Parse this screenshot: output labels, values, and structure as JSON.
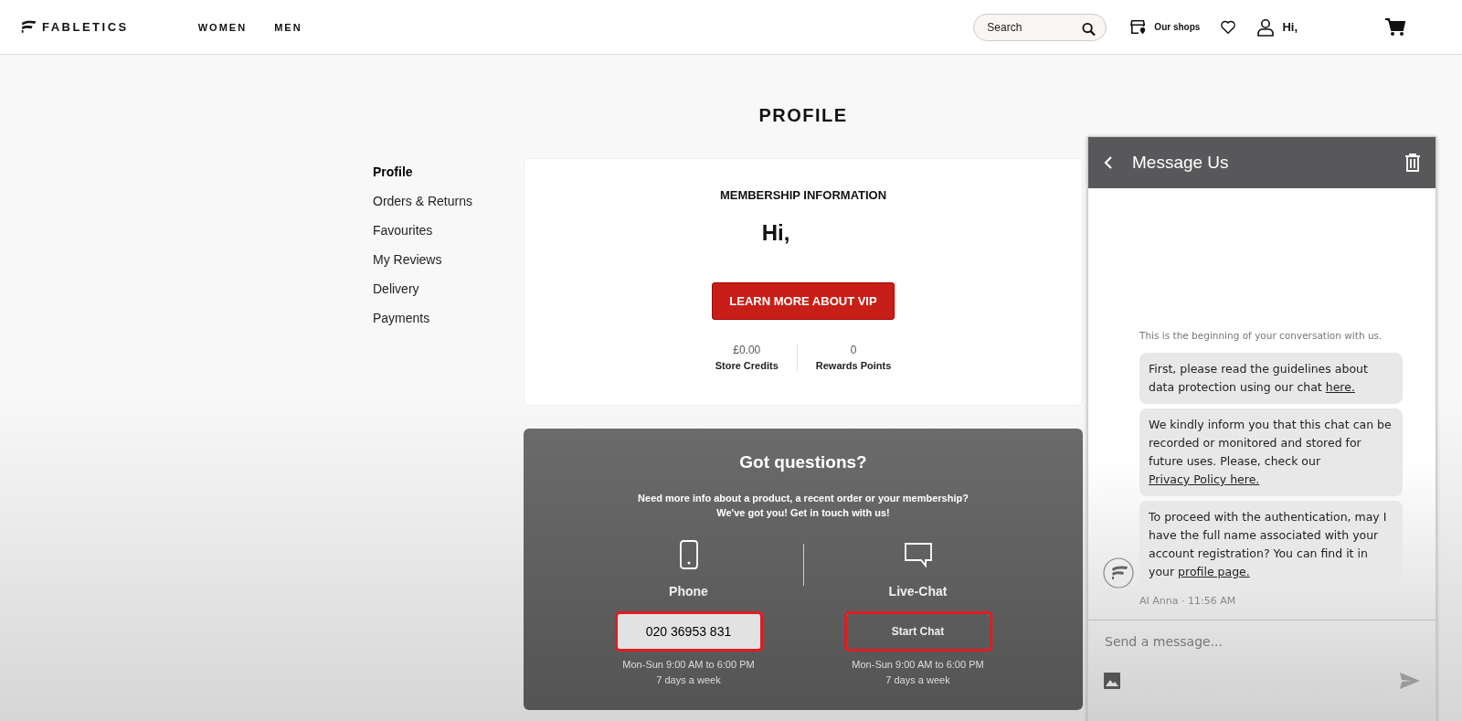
{
  "header": {
    "logo": "FABLETICS",
    "nav": [
      {
        "label": "WOMEN"
      },
      {
        "label": "MEN"
      }
    ],
    "search": {
      "placeholder": "Search"
    },
    "shops": "Our shops",
    "greeting": "Hi,"
  },
  "page_title": "PROFILE",
  "sidebar": {
    "items": [
      {
        "label": "Profile",
        "selected": true
      },
      {
        "label": "Orders & Returns",
        "selected": false
      },
      {
        "label": "Favourites",
        "selected": false
      },
      {
        "label": "My Reviews",
        "selected": false
      },
      {
        "label": "Delivery",
        "selected": false
      },
      {
        "label": "Payments",
        "selected": false
      }
    ]
  },
  "membership": {
    "title": "MEMBERSHIP INFORMATION",
    "greeting": "Hi,",
    "button": "LEARN MORE ABOUT VIP",
    "stats": [
      {
        "value": "£0.00",
        "label": "Store Credits"
      },
      {
        "value": "0",
        "label": "Rewards Points"
      }
    ]
  },
  "questions": {
    "title": "Got questions?",
    "text": [
      "Need more info about a product, a recent order or your membership?",
      "We've got you! Get in touch with us!"
    ],
    "options": [
      {
        "kind": "phone",
        "label": "Phone",
        "button": "020 36953 831",
        "highlighted": true,
        "hours": "Mon-Sun 9:00 AM to 6:00 PM",
        "days": "7 days a week"
      },
      {
        "kind": "chat",
        "label": "Live-Chat",
        "button": "Start Chat",
        "highlighted": true,
        "hours": "Mon-Sun 9:00 AM to 6:00 PM",
        "days": "7 days a week"
      }
    ]
  },
  "chat": {
    "title": "Message Us",
    "intro": "This is the beginning of your conversation with us.",
    "messages": [
      {
        "parts": [
          {
            "kind": "text",
            "text": "First, please read the guidelines about data protection using our chat "
          },
          {
            "kind": "link",
            "text": "here."
          }
        ]
      },
      {
        "parts": [
          {
            "kind": "text",
            "text": "We kindly inform you that this chat can be recorded or monitored and stored for future uses. Please, check our "
          },
          {
            "kind": "link",
            "text": "Privacy Policy here."
          }
        ]
      },
      {
        "parts": [
          {
            "kind": "text",
            "text": "To proceed with the authentication, may I have the full name associated with your account registration? You can find it in your "
          },
          {
            "kind": "link",
            "text": "profile page."
          }
        ]
      }
    ],
    "meta": "AI Anna · 11:56 AM",
    "input": {
      "placeholder": "Send a message..."
    }
  }
}
